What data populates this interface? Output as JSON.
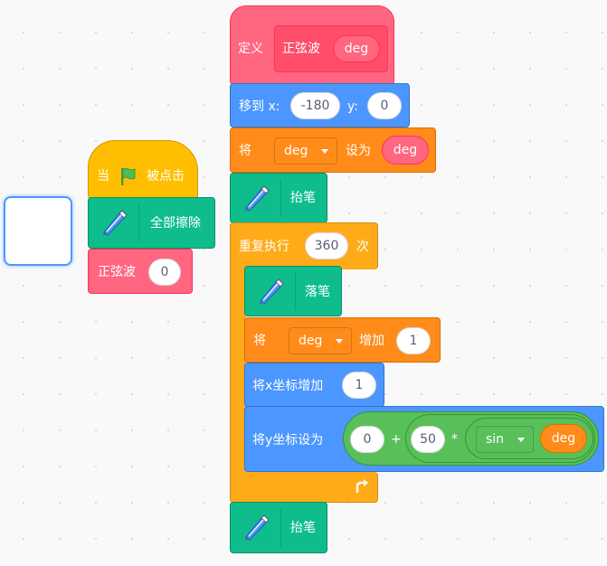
{
  "stage_thumbnail": {},
  "flag_script": {
    "when_flag": {
      "pre": "当",
      "post": "被点击"
    },
    "clear_all": "全部擦除",
    "call_sine": {
      "label": "正弦波",
      "arg": "0"
    }
  },
  "main_script": {
    "define": {
      "keyword": "定义",
      "name": "正弦波",
      "param": "deg"
    },
    "goto": {
      "label": "移到 x:",
      "x": "-180",
      "y_label": "y:",
      "y": "0"
    },
    "set_var": {
      "pre": "将",
      "var": "deg",
      "mid": "设为",
      "value": "deg"
    },
    "pen_up_1": "抬笔",
    "repeat": {
      "label": "重复执行",
      "times": "360",
      "unit": "次"
    },
    "pen_down": "落笔",
    "change_var": {
      "pre": "将",
      "var": "deg",
      "mid": "增加",
      "value": "1"
    },
    "change_x": {
      "label": "将x坐标增加",
      "value": "1"
    },
    "set_y": {
      "label": "将y坐标设为",
      "a": "0",
      "plus": "+",
      "b": "50",
      "times": "*",
      "func": "sin",
      "arg": "deg"
    },
    "pen_up_2": "抬笔"
  },
  "colors": {
    "motion": "#4c97ff",
    "events": "#ffbf00",
    "control": "#ffab19",
    "variables": "#ff8c1a",
    "pen": "#0fbd8c",
    "custom": "#ff6680",
    "operators": "#59c059"
  }
}
